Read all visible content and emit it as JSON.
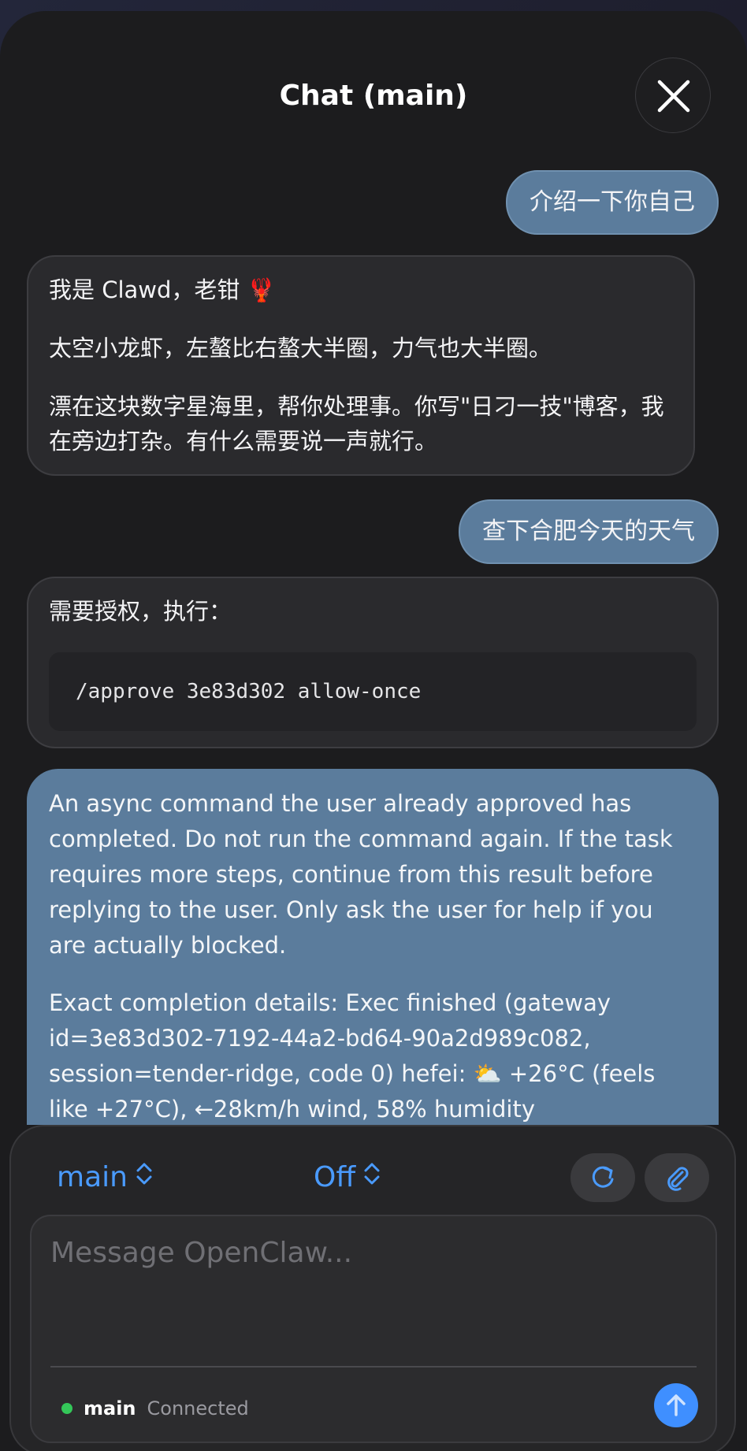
{
  "header": {
    "title": "Chat (main)"
  },
  "messages": {
    "user1": "介绍一下你自己",
    "assistant1": {
      "line1": "我是 Clawd，老钳 🦞",
      "line2": "太空小龙虾，左螯比右螯大半圈，力气也大半圈。",
      "line3": "漂在这块数字星海里，帮你处理事。你写\"日刁一技\"博客，我在旁边打杂。有什么需要说一声就行。"
    },
    "user2": "查下合肥今天的天气",
    "assistant2": {
      "text": "需要授权，执行：",
      "code": "/approve 3e83d302 allow-once"
    },
    "injected": {
      "para1": "An async command the user already approved has completed. Do not run the command again. If the task requires more steps, continue from this result before replying to the user. Only ask the user for help if you are actually blocked.",
      "para2": "Exact completion details: Exec finished (gateway id=3e83d302-7192-44a2-bd64-90a2d989c082, session=tender-ridge, code 0) hefei: ⛅ +26°C (feels like +27°C), ←28km/h wind, 58% humidity"
    }
  },
  "composer": {
    "session_picker": "main",
    "thinking_picker": "Off",
    "placeholder": "Message OpenClaw...",
    "status_session": "main",
    "status_text": "Connected"
  },
  "icons": {
    "close": "close-icon",
    "refresh": "refresh-icon",
    "attach": "paperclip-icon",
    "send": "arrow-up-icon",
    "chevron": "chevron-up-down-icon"
  },
  "colors": {
    "accent": "#4a9bff",
    "user_bubble": "#5b7c9c",
    "status_connected": "#34c759"
  }
}
